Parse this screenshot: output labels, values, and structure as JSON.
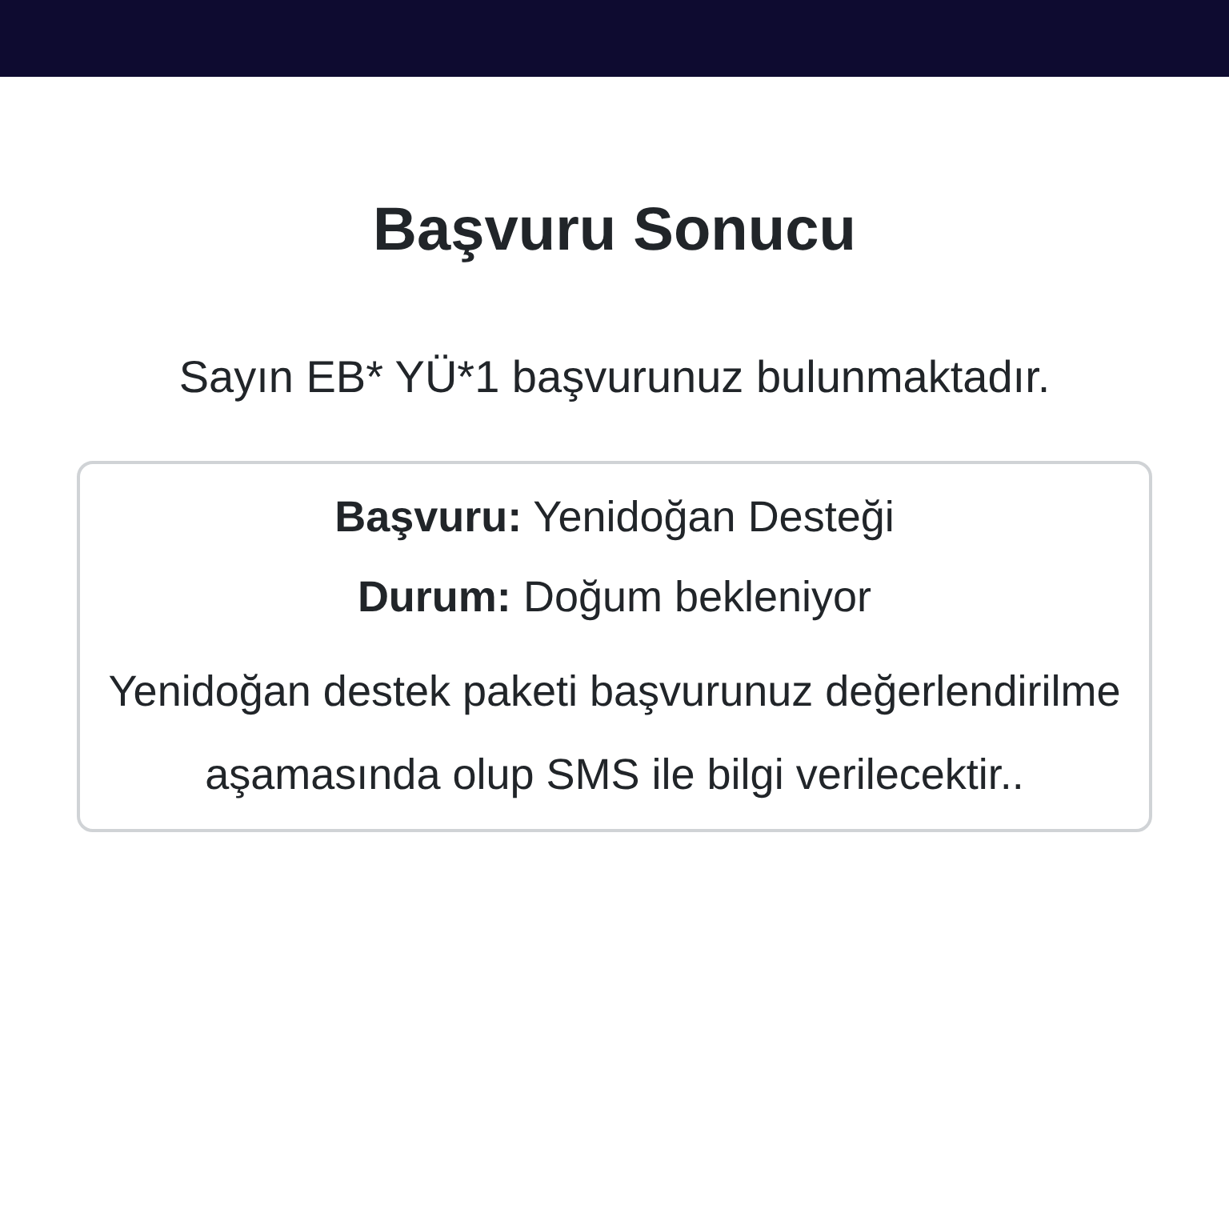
{
  "title": "Başvuru Sonucu",
  "message": "Sayın EB* YÜ*1 başvurunuz bulunmaktadır.",
  "card": {
    "lines": [
      "**Başvuru:** Yenidoğan Desteği",
      "**Durum:** Doğum bekleniyor"
    ],
    "note": "Yenidoğan destek paketi başvurunuz değerlendirilme aşamasında olup SMS ile bilgi verilecektir.."
  }
}
